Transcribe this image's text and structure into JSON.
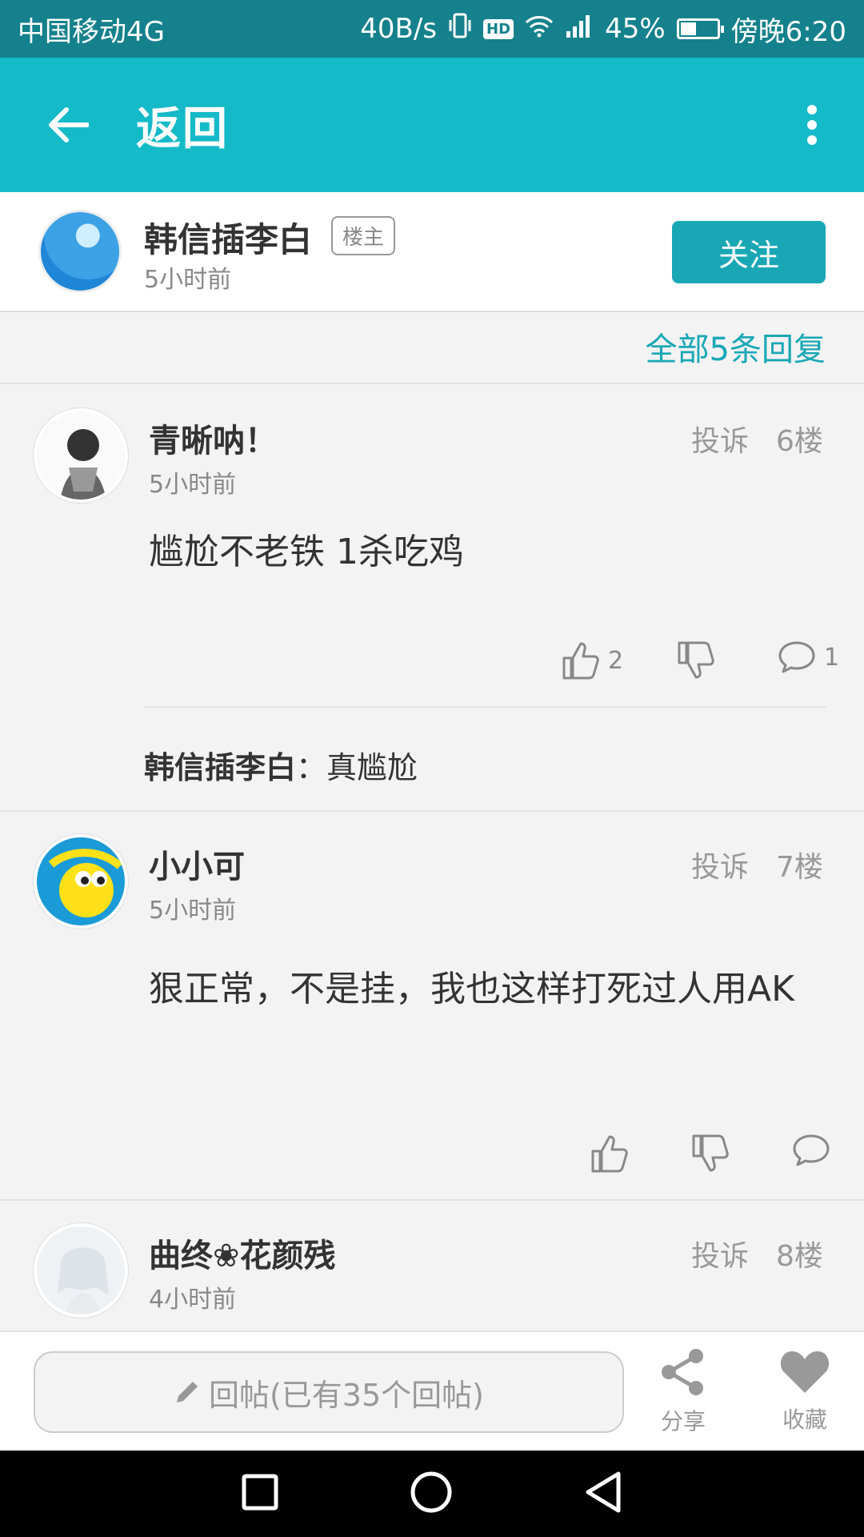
{
  "statusbar": {
    "carrier": "中国移动4G",
    "speed": "40B/s",
    "hd": "HD",
    "network": "4G",
    "battery": "45%",
    "time": "傍晚6:20"
  },
  "toolbar": {
    "title": "返回"
  },
  "author": {
    "name": "韩信插李白",
    "tag": "楼主",
    "time": "5小时前",
    "follow": "关注"
  },
  "all_replies": "全部5条回复",
  "replies": [
    {
      "name": "青晰呐！",
      "time": "5小时前",
      "report": "投诉",
      "floor": "6楼",
      "content": "尴尬不老铁  1杀吃鸡",
      "likes": "2",
      "comments": "1",
      "sub_reply": {
        "name": "韩信插李白",
        "sep": "：",
        "text": "真尴尬"
      }
    },
    {
      "name": "小小可",
      "time": "5小时前",
      "report": "投诉",
      "floor": "7楼",
      "content": "狠正常，不是挂，我也这样打死过人用AK"
    },
    {
      "name": "曲终❀花颜残",
      "time": "4小时前",
      "report": "投诉",
      "floor": "8楼"
    }
  ],
  "bottom": {
    "reply_placeholder": "回帖(已有35个回帖)",
    "share": "分享",
    "favorite": "收藏"
  }
}
